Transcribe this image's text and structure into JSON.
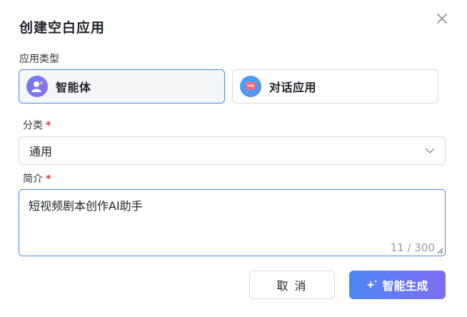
{
  "dialog": {
    "title": "创建空白应用",
    "close_icon": "close-icon"
  },
  "app_type": {
    "label": "应用类型",
    "options": [
      {
        "label": "智能体",
        "icon": "robot-avatar-icon",
        "selected": true
      },
      {
        "label": "对话应用",
        "icon": "chat-bubble-icon",
        "selected": false
      }
    ]
  },
  "category": {
    "label": "分类",
    "required_mark": "*",
    "value": "通用"
  },
  "description": {
    "label": "简介",
    "required_mark": "*",
    "value": "短视频剧本创作AI助手",
    "counter": "11 / 300"
  },
  "buttons": {
    "cancel_label": "取 消",
    "generate_label": "智能生成"
  },
  "colors": {
    "accent": "#4a86e8",
    "required": "#d63a3a",
    "generate_gradient_start": "#4d86f5",
    "generate_gradient_end": "#7f6ef3"
  }
}
